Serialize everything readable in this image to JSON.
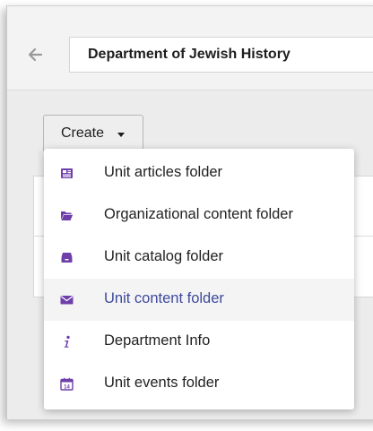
{
  "header": {
    "title": "Department of Jewish History",
    "back_icon": "arrow-left-icon"
  },
  "toolbar": {
    "create_label": "Create"
  },
  "colors": {
    "icon_purple": "#6f3fa9",
    "hover_text": "#3d4a9b",
    "hover_bg": "#f4f4f5"
  },
  "menu": {
    "items": [
      {
        "label": "Unit articles folder",
        "icon": "newspaper-icon"
      },
      {
        "label": "Organizational content folder",
        "icon": "folder-open-icon"
      },
      {
        "label": "Unit catalog folder",
        "icon": "archive-icon"
      },
      {
        "label": "Unit content folder",
        "icon": "envelope-icon",
        "hovered": true
      },
      {
        "label": "Department Info",
        "icon": "info-icon"
      },
      {
        "label": "Unit events folder",
        "icon": "calendar-icon",
        "day": "14"
      }
    ]
  }
}
